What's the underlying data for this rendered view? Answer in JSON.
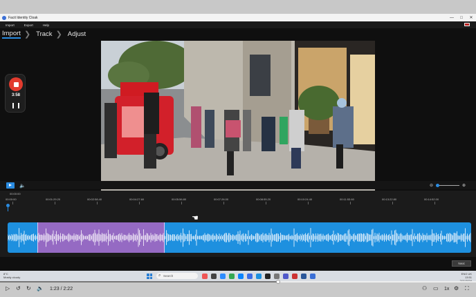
{
  "window": {
    "title": "Facit Identity Cloak",
    "controls": [
      "—",
      "□",
      "✕"
    ]
  },
  "menu": [
    "Import",
    "Export",
    "Help"
  ],
  "steps": [
    {
      "label": "Import",
      "active": true
    },
    {
      "label": "Track",
      "active": false
    },
    {
      "label": "Adjust",
      "active": false
    }
  ],
  "recording": {
    "time": "3:58"
  },
  "timeline": {
    "top_label": "00:00:00",
    "labels": [
      "00:00:00",
      "00:01:29.20",
      "00:02:58.40",
      "00:04:27.60",
      "00:05:56.80",
      "00:07:26.00",
      "00:08:55.20",
      "00:10:24.40",
      "00:11:53.60",
      "00:13:22.80",
      "00:14:52.00"
    ]
  },
  "next_label": "Next",
  "taskbar": {
    "weather_temp": "8°C",
    "weather_desc": "Mostly cloudy",
    "search_placeholder": "Search",
    "tray_lang": "ENG UK",
    "tray_time": "13:51",
    "tray_date": "2/11/2024"
  },
  "player": {
    "time": "1:23 / 2:22",
    "speed": "1x",
    "progress": 0.585
  },
  "colors": {
    "accent": "#2a8be0",
    "record": "#e23b2e",
    "waveform": "#1e90df",
    "selection": "#aa64be"
  }
}
